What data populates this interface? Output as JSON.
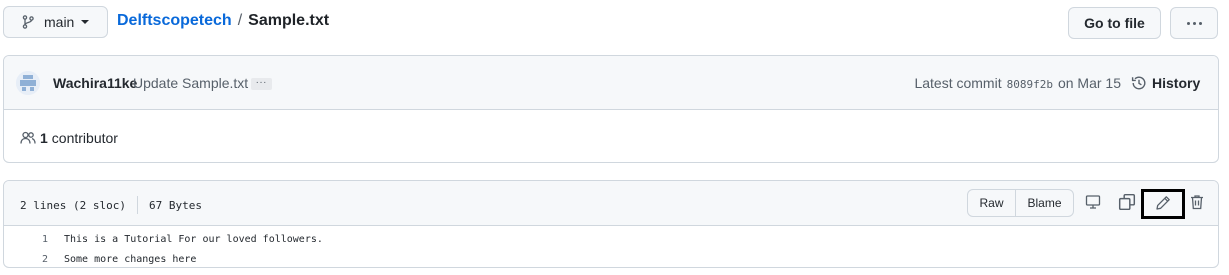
{
  "branch": {
    "name": "main"
  },
  "breadcrumb": {
    "repo": "Delftscopetech",
    "separator": "/",
    "file": "Sample.txt"
  },
  "header_actions": {
    "go_to_file": "Go to file"
  },
  "commit": {
    "author": "Wachira11ke",
    "message": "Update Sample.txt",
    "ellipsis": "...",
    "latest_label": "Latest commit",
    "sha": "8089f2b",
    "date": "on Mar 15",
    "history_label": "History"
  },
  "contributors": {
    "count": "1",
    "label": "contributor"
  },
  "file": {
    "lines_info": "2 lines (2 sloc)",
    "size": "67 Bytes",
    "raw_label": "Raw",
    "blame_label": "Blame",
    "lines": [
      {
        "number": "1",
        "text": "This is a Tutorial For our loved followers."
      },
      {
        "number": "2",
        "text": "Some more changes here"
      }
    ]
  },
  "colors": {
    "link": "#0969da",
    "border": "#d0d7de",
    "header_bg": "#f6f8fa",
    "highlight_box": "#000000"
  },
  "icons": [
    "git-branch-icon",
    "chevron-down-icon",
    "kebab-horizontal-icon",
    "history-icon",
    "people-icon",
    "desktop-icon",
    "copy-icon",
    "pencil-icon",
    "trash-icon"
  ]
}
